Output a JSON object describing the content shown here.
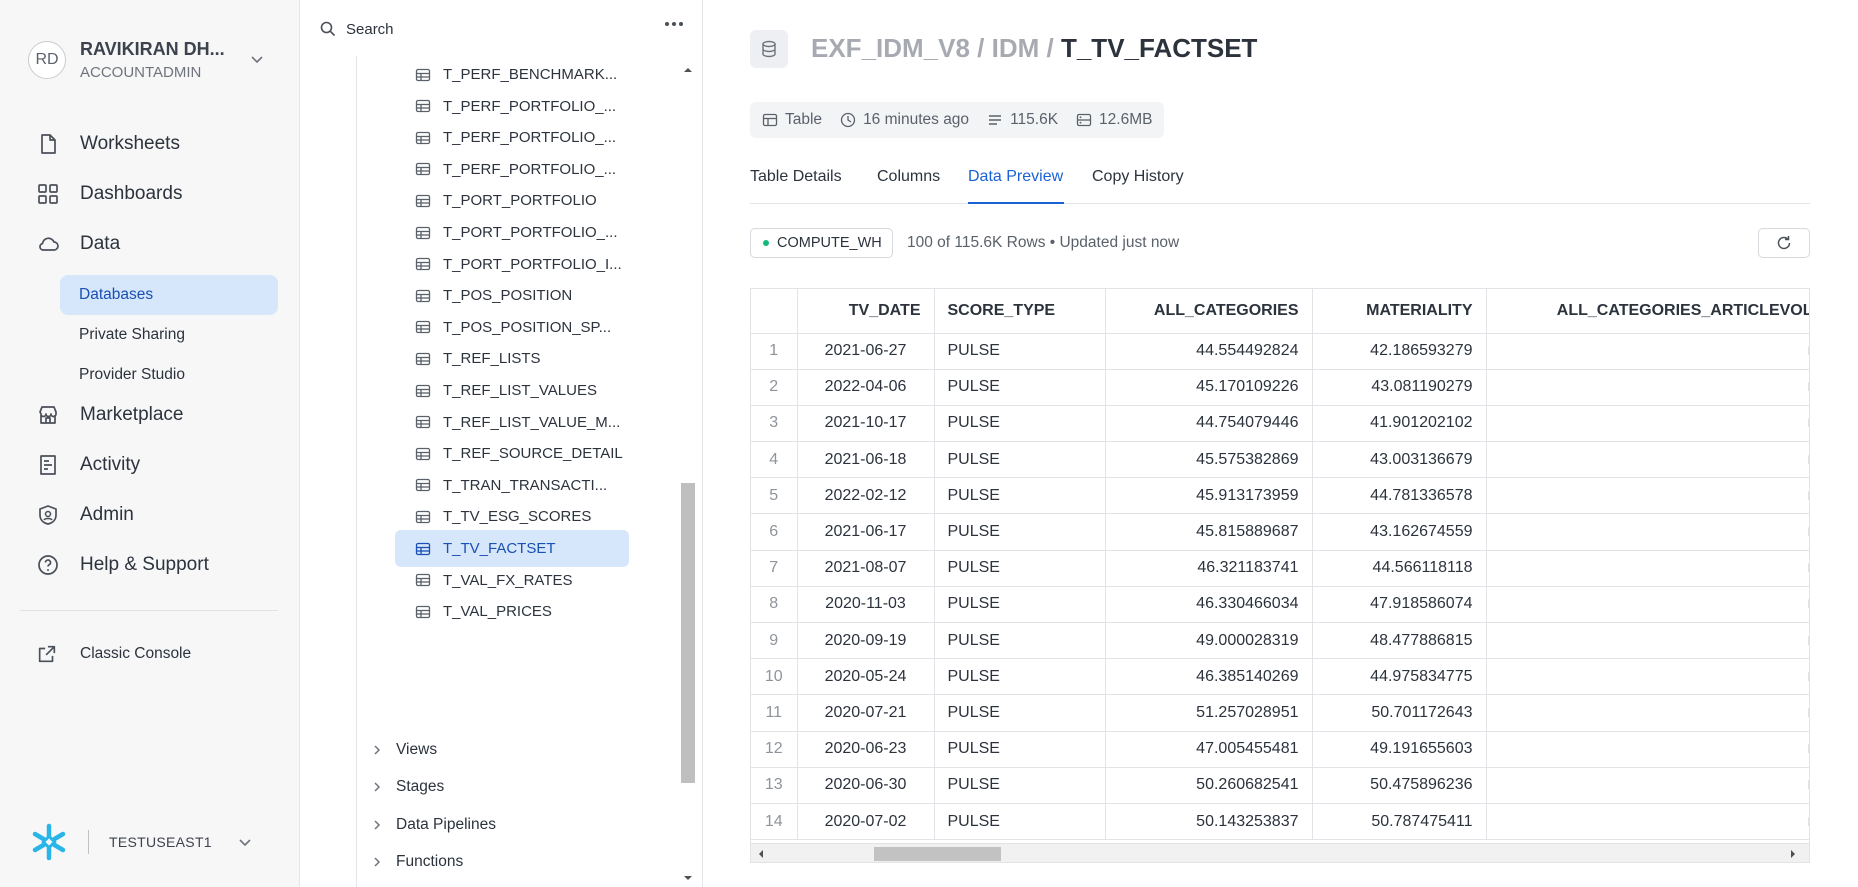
{
  "user": {
    "initials": "RD",
    "name": "RAVIKIRAN DH...",
    "role": "ACCOUNTADMIN"
  },
  "nav": {
    "items": [
      {
        "label": "Worksheets",
        "icon": "file-icon"
      },
      {
        "label": "Dashboards",
        "icon": "grid-icon"
      },
      {
        "label": "Data",
        "icon": "cloud-icon"
      },
      {
        "label": "Marketplace",
        "icon": "store-icon"
      },
      {
        "label": "Activity",
        "icon": "activity-icon"
      },
      {
        "label": "Admin",
        "icon": "shield-icon"
      },
      {
        "label": "Help & Support",
        "icon": "help-icon"
      }
    ],
    "sub_items": [
      "Databases",
      "Private Sharing",
      "Provider Studio"
    ],
    "classic_console": "Classic Console",
    "account": "TESTUSEAST1"
  },
  "browser": {
    "search_label": "Search",
    "tables": [
      "T_PERF_BENCHMARK...",
      "T_PERF_PORTFOLIO_...",
      "T_PERF_PORTFOLIO_...",
      "T_PERF_PORTFOLIO_...",
      "T_PORT_PORTFOLIO",
      "T_PORT_PORTFOLIO_...",
      "T_PORT_PORTFOLIO_I...",
      "T_POS_POSITION",
      "T_POS_POSITION_SP...",
      "T_REF_LISTS",
      "T_REF_LIST_VALUES",
      "T_REF_LIST_VALUE_M...",
      "T_REF_SOURCE_DETAIL",
      "T_TRAN_TRANSACTI...",
      "T_TV_ESG_SCORES",
      "T_TV_FACTSET",
      "T_VAL_FX_RATES",
      "T_VAL_PRICES"
    ],
    "active_table": "T_TV_FACTSET",
    "folders": [
      "Views",
      "Stages",
      "Data Pipelines",
      "Functions"
    ]
  },
  "main": {
    "breadcrumb": {
      "db": "EXF_IDM_V8",
      "sep1": " / ",
      "schema": "IDM",
      "sep2": " / ",
      "table": "T_TV_FACTSET"
    },
    "meta": {
      "type": "Table",
      "updated": "16 minutes ago",
      "rows": "115.6K",
      "size": "12.6MB"
    },
    "tabs": [
      "Table Details",
      "Columns",
      "Data Preview",
      "Copy History"
    ],
    "active_tab": "Data Preview",
    "warehouse": "COMPUTE_WH",
    "row_info": "100 of 115.6K Rows • Updated just now",
    "columns": [
      "TV_DATE",
      "SCORE_TYPE",
      "ALL_CATEGORIES",
      "MATERIALITY",
      "ALL_CATEGORIES_ARTICLEVOL"
    ],
    "rows": [
      [
        "1",
        "2021-06-27",
        "PULSE",
        "44.554492824",
        "42.186593279",
        "nu"
      ],
      [
        "2",
        "2022-04-06",
        "PULSE",
        "45.170109226",
        "43.081190279",
        "nu"
      ],
      [
        "3",
        "2021-10-17",
        "PULSE",
        "44.754079446",
        "41.901202102",
        "nu"
      ],
      [
        "4",
        "2021-06-18",
        "PULSE",
        "45.575382869",
        "43.003136679",
        "nu"
      ],
      [
        "5",
        "2022-02-12",
        "PULSE",
        "45.913173959",
        "44.781336578",
        "nu"
      ],
      [
        "6",
        "2021-06-17",
        "PULSE",
        "45.815889687",
        "43.162674559",
        "nu"
      ],
      [
        "7",
        "2021-08-07",
        "PULSE",
        "46.321183741",
        "44.566118118",
        "nu"
      ],
      [
        "8",
        "2020-11-03",
        "PULSE",
        "46.330466034",
        "47.918586074",
        "nu"
      ],
      [
        "9",
        "2020-09-19",
        "PULSE",
        "49.000028319",
        "48.477886815",
        "nu"
      ],
      [
        "10",
        "2020-05-24",
        "PULSE",
        "46.385140269",
        "44.975834775",
        "nu"
      ],
      [
        "11",
        "2020-07-21",
        "PULSE",
        "51.257028951",
        "50.701172643",
        "nu"
      ],
      [
        "12",
        "2020-06-23",
        "PULSE",
        "47.005455481",
        "49.191655603",
        "nu"
      ],
      [
        "13",
        "2020-06-30",
        "PULSE",
        "50.260682541",
        "50.475896236",
        "nu"
      ],
      [
        "14",
        "2020-07-02",
        "PULSE",
        "50.143253837",
        "50.787475411",
        "nu"
      ]
    ]
  },
  "colors": {
    "accent": "#1a62d6",
    "active_bg": "#d6e6fb",
    "snowflake": "#29b5e8",
    "status_green": "#14b87a"
  }
}
